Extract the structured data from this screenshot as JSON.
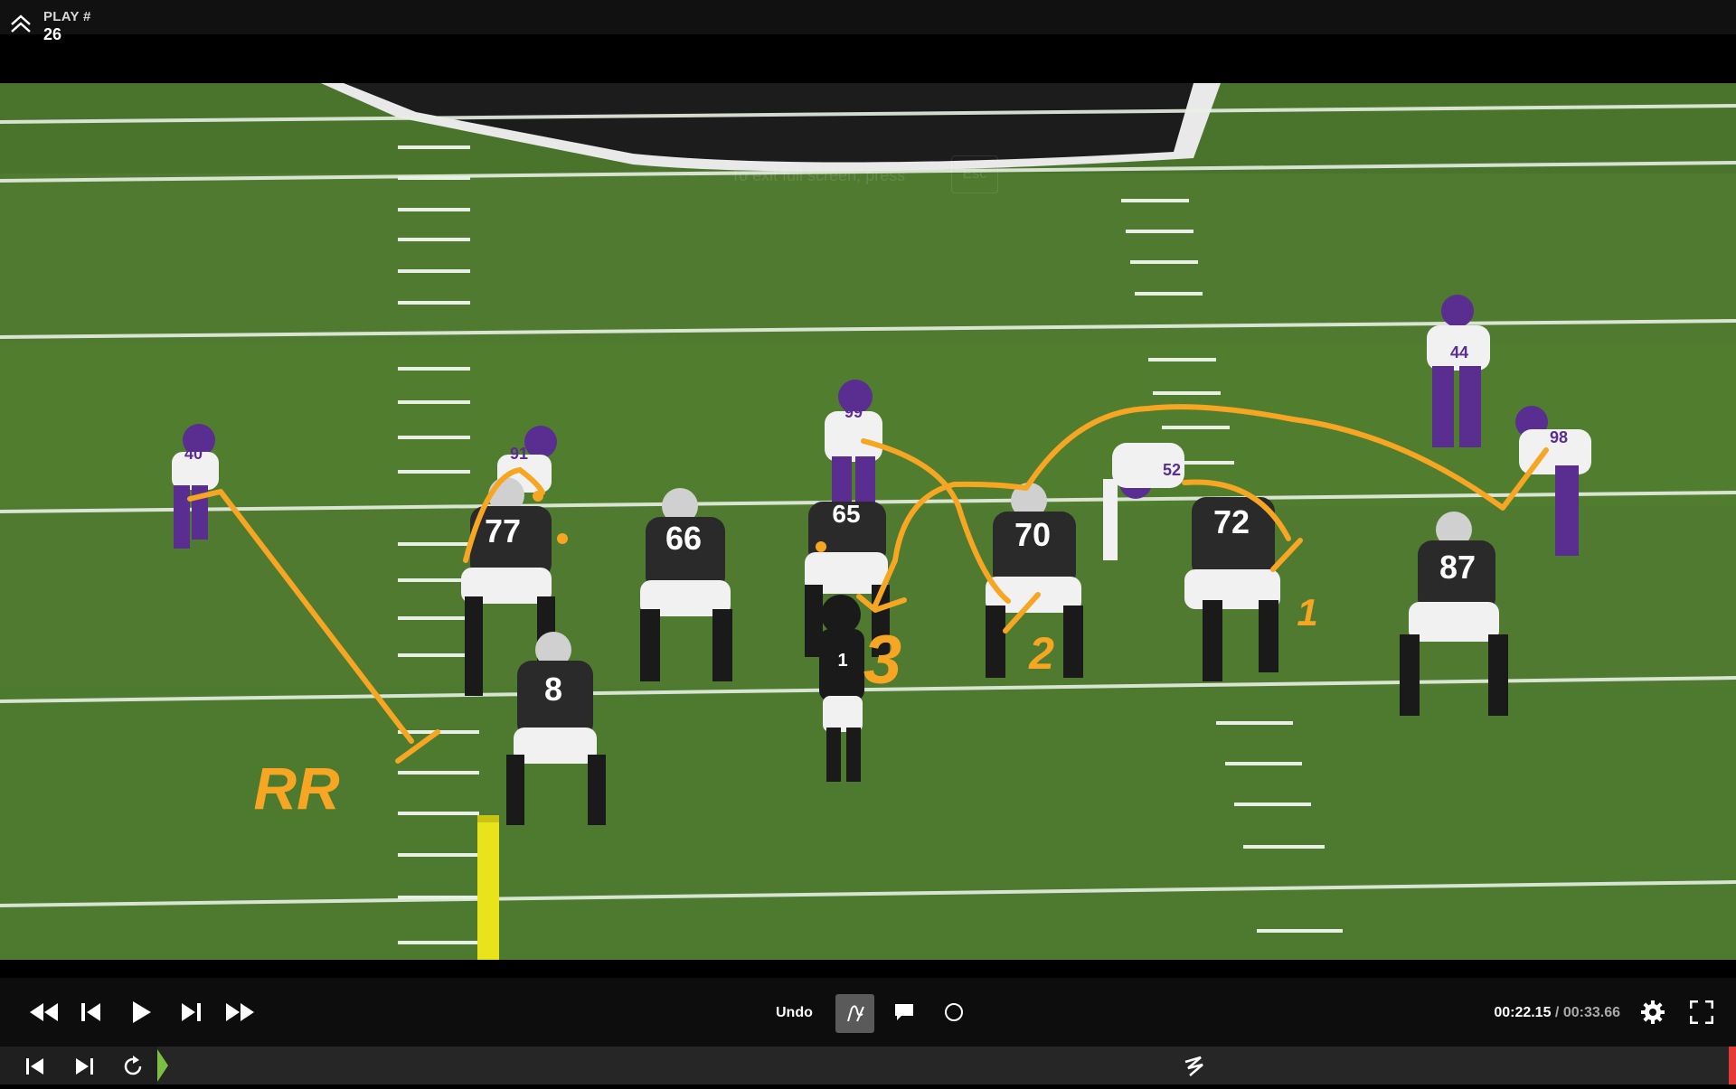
{
  "header": {
    "play_label": "PLAY #",
    "play_number": "26"
  },
  "video": {
    "exit_hint": "To exit full screen, press",
    "exit_key": "Esc",
    "jersey_numbers": {
      "offense": [
        "77",
        "66",
        "65",
        "70",
        "72",
        "87",
        "8",
        "1"
      ],
      "defense": [
        "40",
        "91",
        "99",
        "52",
        "98",
        "44"
      ]
    },
    "annotations": {
      "route_label": "RR",
      "gap_labels": [
        "1",
        "2",
        "3"
      ]
    },
    "colors": {
      "drawing": "#f6a623",
      "field": "#4f7a2f",
      "home_jersey": "#2a2a2a",
      "away_helmet": "#5a2d91"
    }
  },
  "controls": {
    "undo_label": "Undo",
    "current_time": "00:22.15",
    "total_time": "00:33.66",
    "separator": " / ",
    "icons": [
      "rewind-icon",
      "step-back-icon",
      "play-icon",
      "step-forward-icon",
      "fast-forward-icon",
      "pen-icon",
      "comment-icon",
      "circle-icon",
      "gear-icon",
      "fullscreen-icon"
    ]
  },
  "timeline": {
    "icons": [
      "skip-start-icon",
      "skip-end-icon",
      "replay-icon",
      "marker-icon"
    ],
    "start_marker_color": "#7bc043",
    "end_marker_color": "#e53935"
  }
}
